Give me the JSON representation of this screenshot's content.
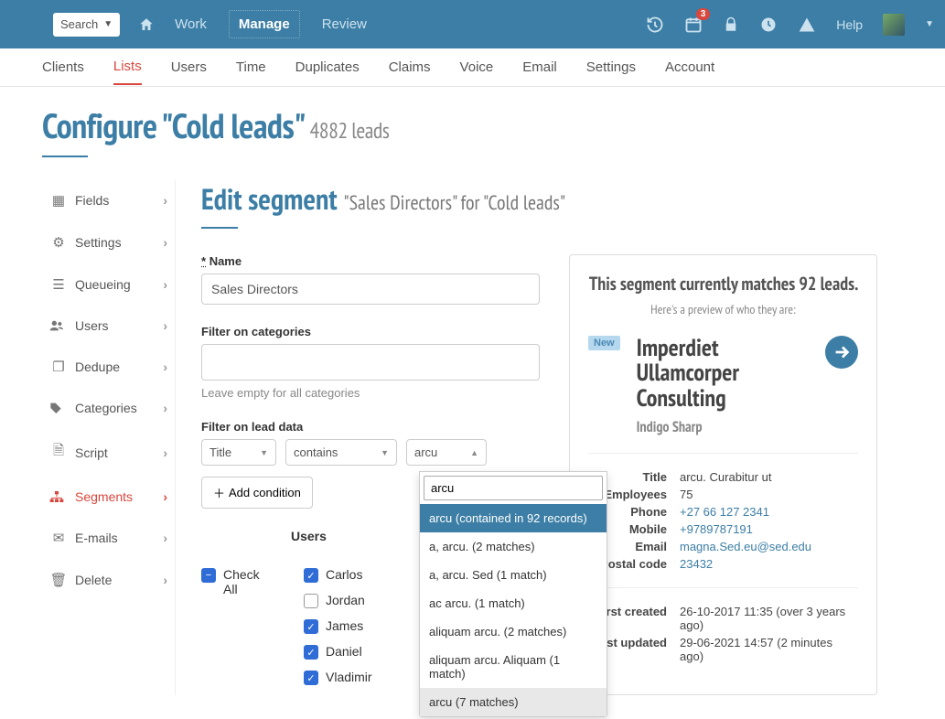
{
  "topbar": {
    "search_label": "Search",
    "nav": {
      "work": "Work",
      "manage": "Manage",
      "review": "Review"
    },
    "badge_count": "3",
    "help": "Help"
  },
  "subnav": {
    "clients": "Clients",
    "lists": "Lists",
    "users": "Users",
    "time": "Time",
    "duplicates": "Duplicates",
    "claims": "Claims",
    "voice": "Voice",
    "email": "Email",
    "settings": "Settings",
    "account": "Account"
  },
  "page": {
    "title": "Configure \"Cold leads\"",
    "lead_count": "4882 leads"
  },
  "sidebar": {
    "items": [
      {
        "label": "Fields"
      },
      {
        "label": "Settings"
      },
      {
        "label": "Queueing"
      },
      {
        "label": "Users"
      },
      {
        "label": "Dedupe"
      },
      {
        "label": "Categories"
      },
      {
        "label": "Script"
      },
      {
        "label": "Segments"
      },
      {
        "label": "E-mails"
      },
      {
        "label": "Delete"
      }
    ]
  },
  "editor": {
    "heading": "Edit segment",
    "subheading": "\"Sales Directors\" for \"Cold leads\"",
    "name_label": "Name",
    "name_value": "Sales Directors",
    "cat_label": "Filter on categories",
    "cat_hint": "Leave empty for all categories",
    "lead_filter_label": "Filter on lead data",
    "field_sel": "Title",
    "op_sel": "contains",
    "val_sel": "arcu",
    "add_condition": "Add condition",
    "users_heading": "Users",
    "check_all": "Check All",
    "users": [
      "Carlos",
      "Jordan",
      "James",
      "Daniel",
      "Vladimir"
    ],
    "users_checked": [
      true,
      false,
      true,
      true,
      true
    ]
  },
  "dropdown": {
    "search": "arcu",
    "options": [
      "arcu (contained in 92 records)",
      "a, arcu. (2 matches)",
      "a, arcu. Sed (1 match)",
      "ac arcu. (1 match)",
      "aliquam arcu. (2 matches)",
      "aliquam arcu. Aliquam (1 match)",
      "arcu (7 matches)"
    ]
  },
  "preview": {
    "heading": "This segment currently matches 92 leads.",
    "subheading": "Here's a preview of who they are:",
    "new_tag": "New",
    "company": "Imperdiet Ullamcorper Consulting",
    "contact": "Indigo Sharp",
    "fields": {
      "title_k": "Title",
      "title_v": "arcu. Curabitur ut",
      "emp_k": "Employees",
      "emp_v": "75",
      "phone_k": "Phone",
      "phone_v": "+27 66 127 2341",
      "mobile_k": "Mobile",
      "mobile_v": "+9789787191",
      "email_k": "Email",
      "email_v": "magna.Sed.eu@sed.edu",
      "postal_k": "Postal code",
      "postal_v": "23432",
      "created_k": "First created",
      "created_v": "26-10-2017 11:35 (over 3 years ago)",
      "updated_k": "Last updated",
      "updated_v": "29-06-2021 14:57 (2 minutes ago)"
    }
  }
}
